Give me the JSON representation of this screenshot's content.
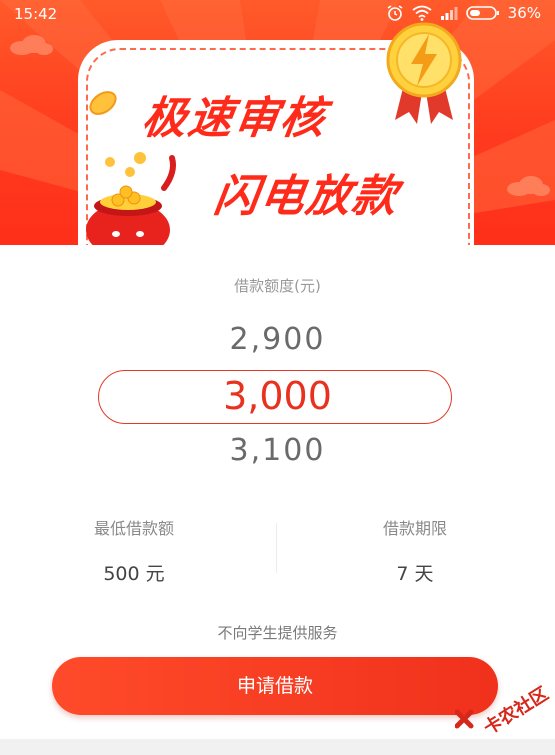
{
  "status_bar": {
    "time": "15:42",
    "battery": "36%"
  },
  "banner": {
    "headline_line1": "极速审核",
    "headline_line2": "闪电放款",
    "colors": {
      "primary": "#ff3b1e",
      "accent": "#ffd43b"
    }
  },
  "amount_picker": {
    "label": "借款额度(元)",
    "previous": "2,900",
    "current": "3,000",
    "next": "3,100"
  },
  "info": {
    "min_label": "最低借款额",
    "min_value": "500 元",
    "term_label": "借款期限",
    "term_value": "7 天"
  },
  "notice": "不向学生提供服务",
  "apply_button": "申请借款",
  "watermark": "卡农社区"
}
